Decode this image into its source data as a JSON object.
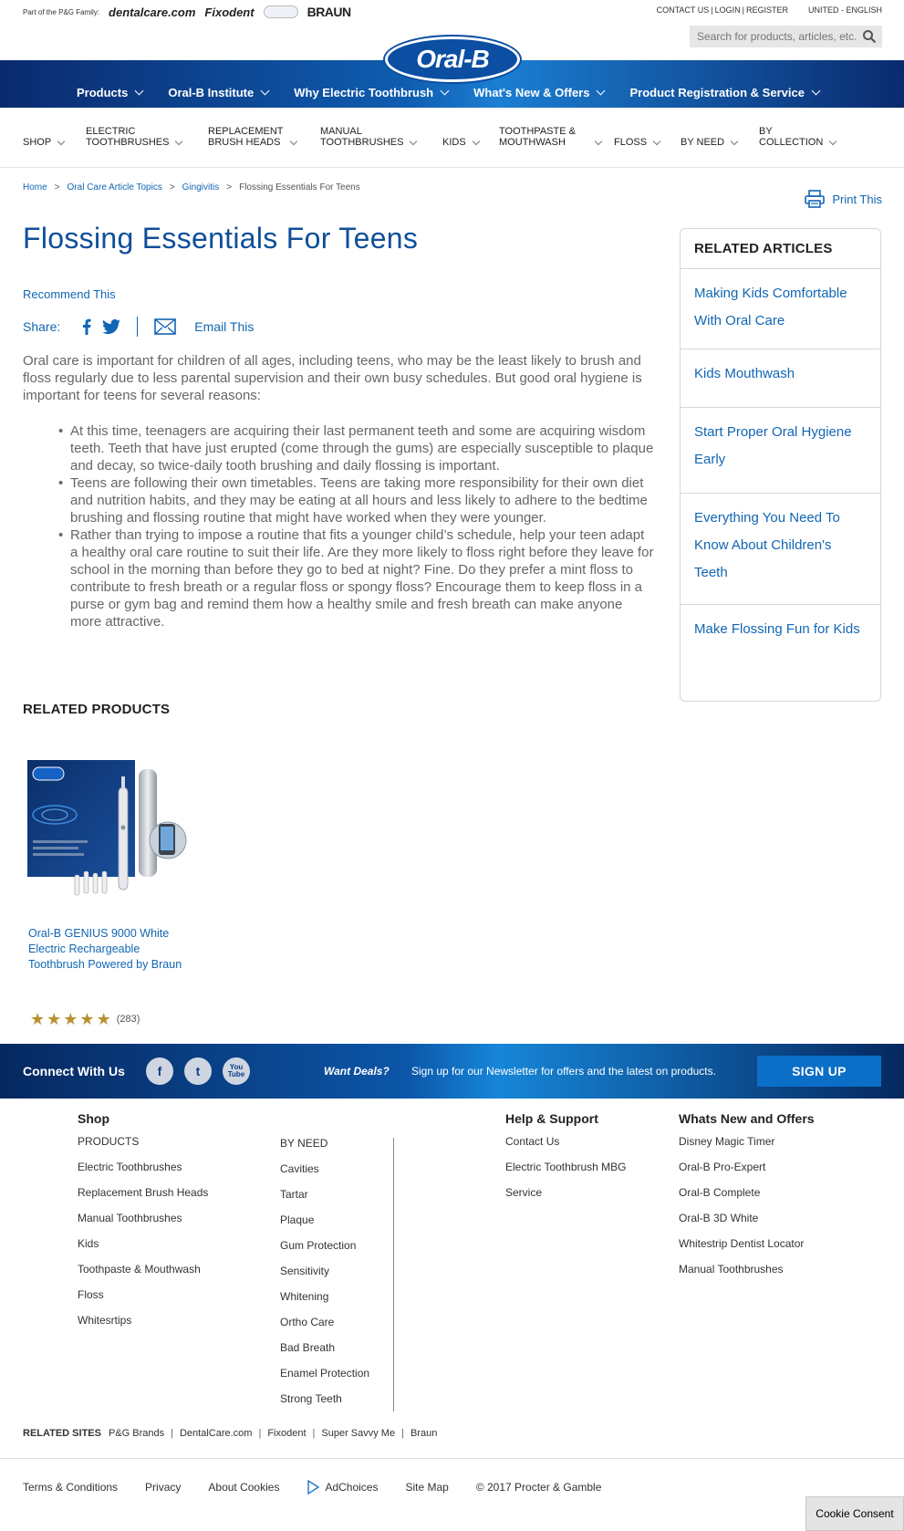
{
  "topbar": {
    "pg_family_label": "Part of the P&G Family:",
    "brands": [
      "dentalcare.com",
      "Fixodent",
      "BRAUN"
    ],
    "util_links": [
      "CONTACT US",
      "LOGIN",
      "REGISTER"
    ],
    "locale": "UNITED - ENGLISH",
    "search_placeholder": "Search for products, articles, etc."
  },
  "logo": {
    "text": "Oral-B"
  },
  "main_nav": [
    "Products",
    "Oral-B Institute",
    "Why Electric Toothbrush",
    "What's New & Offers",
    "Product Registration & Service"
  ],
  "sub_nav": {
    "shop": "SHOP",
    "electric_1": "ELECTRIC",
    "electric_2": "TOOTHBRUSHES",
    "replacement_1": "REPLACEMENT",
    "replacement_2": "BRUSH HEADS",
    "manual_1": "MANUAL",
    "manual_2": "TOOTHBRUSHES",
    "kids": "KIDS",
    "toothpaste_1": "TOOTHPASTE &",
    "toothpaste_2": "MOUTHWASH",
    "floss": "FLOSS",
    "by_need": "BY NEED",
    "by_collection_1": "BY",
    "by_collection_2": "COLLECTION"
  },
  "breadcrumb": {
    "home": "Home",
    "topics": "Oral Care Article Topics",
    "gingivitis": "Gingivitis",
    "current": "Flossing Essentials For Teens",
    "sep": ">"
  },
  "print_label": "Print This",
  "page_title": "Flossing Essentials For Teens",
  "recommend_label": "Recommend This",
  "share_label": "Share:",
  "email_label": "Email This",
  "article": {
    "intro": "Oral care is important for children of all ages, including teens, who may be the least likely to brush and floss regularly due to less parental supervision and their own busy schedules. But good oral hygiene is important for teens for several reasons:",
    "bullets": [
      "At this time, teenagers are acquiring their last permanent teeth and some are acquiring wisdom teeth. Teeth that have just erupted (come through the gums) are especially susceptible to plaque and decay, so twice-daily tooth brushing and daily flossing is important.",
      "Teens are following their own timetables. Teens are taking more responsibility for their own diet and nutrition habits, and they may be eating at all hours and less likely to adhere to the bedtime brushing and flossing routine that might have worked when they were younger.",
      "Rather than trying to impose a routine that fits a younger child’s schedule, help your teen adapt a healthy oral care routine to suit their life. Are they more likely to floss right before they leave for school in the morning than before they go to bed at night? Fine. Do they prefer a mint floss to contribute to fresh breath or a regular floss or spongy floss? Encourage them to keep floss in a purse or gym bag and remind them how a healthy smile and fresh breath can make anyone more attractive."
    ]
  },
  "related_articles": {
    "title": "RELATED ARTICLES",
    "items": [
      "Making Kids Comfortable With Oral Care",
      "Kids Mouthwash",
      "Start Proper Oral Hygiene Early",
      "Everything You Need To Know About Children's Teeth",
      "Make Flossing Fun for Kids"
    ]
  },
  "related_products": {
    "title": "RELATED PRODUCTS",
    "product_name": "Oral-B GENIUS 9000 White Electric Rechargeable Toothbrush Powered by Braun",
    "rating_stars": 5,
    "review_count": "(283)"
  },
  "connect": {
    "title": "Connect With Us",
    "icons": [
      "f",
      "t",
      "You Tube"
    ],
    "deals_label": "Want Deals?",
    "deals_desc": "Sign up for our Newsletter for offers and the latest on products.",
    "signup": "SIGN UP"
  },
  "footer": {
    "shop_title": "Shop",
    "products": [
      "PRODUCTS",
      "Electric Toothbrushes",
      "Replacement Brush Heads",
      "Manual Toothbrushes",
      "Kids",
      "Toothpaste & Mouthwash",
      "Floss",
      "Whitesrtips"
    ],
    "by_need": [
      "BY NEED",
      "Cavities",
      "Tartar",
      "Plaque",
      "Gum Protection",
      "Sensitivity",
      "Whitening",
      "Ortho Care",
      "Bad Breath",
      "Enamel Protection",
      "Strong Teeth"
    ],
    "help_title": "Help & Support",
    "help": [
      "Contact Us",
      "Electric Toothbrush MBG",
      "Service"
    ],
    "whats_new_title": "Whats New and Offers",
    "whats_new": [
      "Disney Magic Timer",
      "Oral-B Pro-Expert",
      "Oral-B Complete",
      "Oral-B 3D White",
      "Whitestrip Dentist Locator",
      "Manual Toothbrushes"
    ]
  },
  "related_sites": {
    "label": "RELATED SITES",
    "items": [
      "P&G Brands",
      "DentalCare.com",
      "Fixodent",
      "Super Savvy Me",
      "Braun"
    ],
    "sep": "|"
  },
  "legal": {
    "terms": "Terms & Conditions",
    "privacy": "Privacy",
    "cookies": "About Cookies",
    "adchoices": "AdChoices",
    "sitemap": "Site Map",
    "copyright": "© 2017 Procter & Gamble"
  },
  "cookie_consent": "Cookie Consent",
  "colors": {
    "brand_blue": "#0f4f9a",
    "link_blue": "#1166b3",
    "star_gold": "#b8912f"
  }
}
